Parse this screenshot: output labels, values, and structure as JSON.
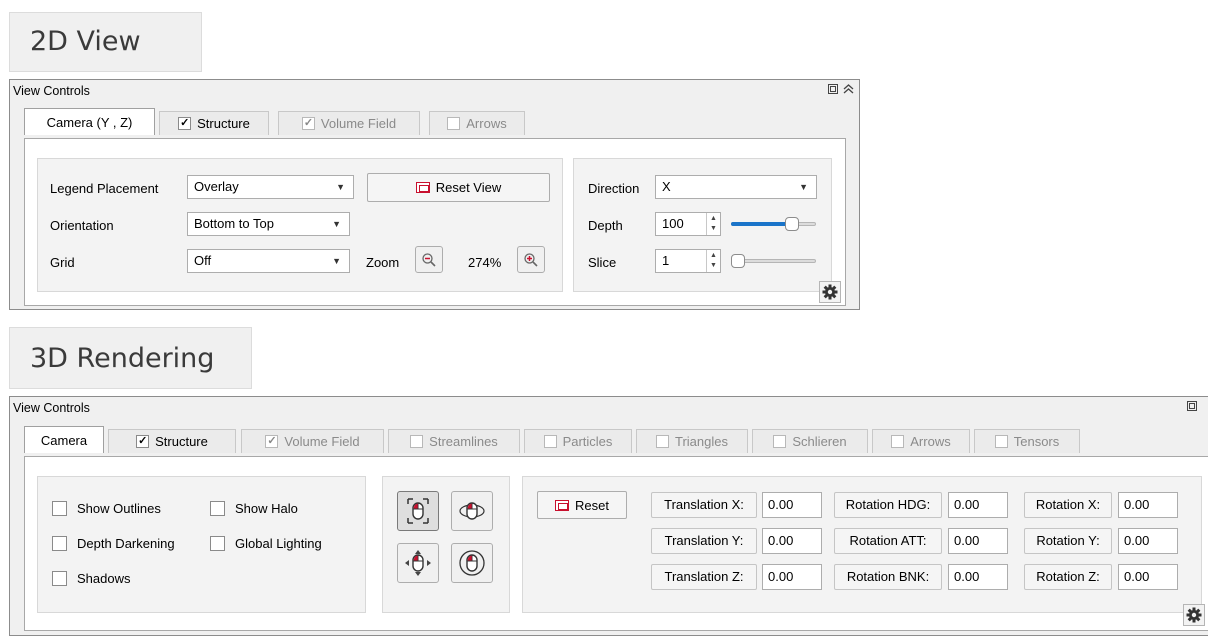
{
  "view2d": {
    "heading": "2D View",
    "panel_title": "View Controls",
    "tabs": [
      {
        "label": "Camera (Y , Z)",
        "checkbox": false,
        "checked": false,
        "disabled": false,
        "active": true
      },
      {
        "label": "Structure",
        "checkbox": true,
        "checked": true,
        "disabled": false,
        "active": false
      },
      {
        "label": "Volume Field",
        "checkbox": true,
        "checked": true,
        "disabled": true,
        "active": false
      },
      {
        "label": "Arrows",
        "checkbox": true,
        "checked": false,
        "disabled": true,
        "active": false
      }
    ],
    "legend_label": "Legend Placement",
    "legend_value": "Overlay",
    "reset_view_label": "Reset View",
    "orientation_label": "Orientation",
    "orientation_value": "Bottom to Top",
    "grid_label": "Grid",
    "grid_value": "Off",
    "zoom_label": "Zoom",
    "zoom_value": "274%",
    "direction_label": "Direction",
    "direction_value": "X",
    "depth_label": "Depth",
    "depth_value": "100",
    "depth_slider_fraction": 0.7,
    "slice_label": "Slice",
    "slice_value": "1",
    "slice_slider_fraction": 0.0
  },
  "view3d": {
    "heading": "3D Rendering",
    "panel_title": "View Controls",
    "tabs": [
      {
        "label": "Camera",
        "checkbox": false,
        "checked": false,
        "disabled": false,
        "active": true
      },
      {
        "label": "Structure",
        "checkbox": true,
        "checked": true,
        "disabled": false,
        "active": false
      },
      {
        "label": "Volume Field",
        "checkbox": true,
        "checked": true,
        "disabled": true,
        "active": false
      },
      {
        "label": "Streamlines",
        "checkbox": true,
        "checked": false,
        "disabled": true,
        "active": false
      },
      {
        "label": "Particles",
        "checkbox": true,
        "checked": false,
        "disabled": true,
        "active": false
      },
      {
        "label": "Triangles",
        "checkbox": true,
        "checked": false,
        "disabled": true,
        "active": false
      },
      {
        "label": "Schlieren",
        "checkbox": true,
        "checked": false,
        "disabled": true,
        "active": false
      },
      {
        "label": "Arrows",
        "checkbox": true,
        "checked": false,
        "disabled": true,
        "active": false
      },
      {
        "label": "Tensors",
        "checkbox": true,
        "checked": false,
        "disabled": true,
        "active": false
      }
    ],
    "options": {
      "show_outlines": "Show Outlines",
      "show_halo": "Show Halo",
      "depth_darkening": "Depth Darkening",
      "global_lighting": "Global Lighting",
      "shadows": "Shadows"
    },
    "reset_label": "Reset",
    "translation_x_label": "Translation X:",
    "translation_x_value": "0.00",
    "translation_y_label": "Translation Y:",
    "translation_y_value": "0.00",
    "translation_z_label": "Translation Z:",
    "translation_z_value": "0.00",
    "rotation_hdg_label": "Rotation HDG:",
    "rotation_hdg_value": "0.00",
    "rotation_att_label": "Rotation ATT:",
    "rotation_att_value": "0.00",
    "rotation_bnk_label": "Rotation BNK:",
    "rotation_bnk_value": "0.00",
    "rotation_x_label": "Rotation X:",
    "rotation_x_value": "0.00",
    "rotation_y_label": "Rotation Y:",
    "rotation_y_value": "0.00",
    "rotation_z_label": "Rotation Z:",
    "rotation_z_value": "0.00"
  },
  "icons": [
    "restore-icon",
    "collapse-icon",
    "reset-icon",
    "zoom-out-icon",
    "zoom-in-icon",
    "gear-icon",
    "mouse-select-icon",
    "mouse-rotate-icon",
    "mouse-pan-icon",
    "mouse-zoom-icon"
  ],
  "colors": {
    "accent": "#1a74c9",
    "icon_red": "#c8102e"
  }
}
